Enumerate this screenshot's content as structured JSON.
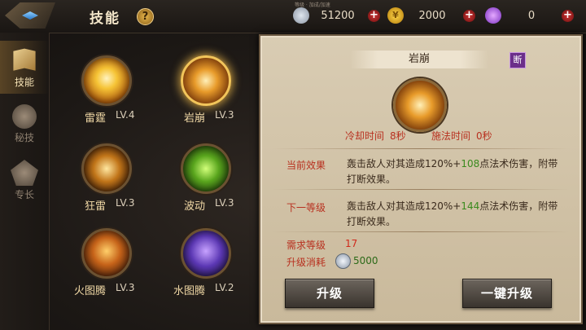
{
  "header": {
    "title": "技能",
    "help": "?",
    "small_tag": "等级 · 加成/加速",
    "resources": [
      {
        "name": "silver",
        "value": "51200",
        "icon": "gear-coin-icon"
      },
      {
        "name": "gold",
        "value": "2000",
        "icon": "gold-coin-icon"
      },
      {
        "name": "orb",
        "value": "0",
        "icon": "purple-orb-icon"
      }
    ],
    "plus": "+",
    "coin_glyph": "¥"
  },
  "nav": {
    "items": [
      {
        "label": "技能",
        "icon": "skill-book-icon",
        "active": true
      },
      {
        "label": "秘技",
        "icon": "secret-emblem-icon",
        "active": false
      },
      {
        "label": "专长",
        "icon": "specialty-emblem-icon",
        "active": false
      }
    ]
  },
  "skills": [
    {
      "name": "雷霆",
      "level": "LV.4",
      "art": "thunder-orb-icon"
    },
    {
      "name": "岩崩",
      "level": "LV.3",
      "art": "rock-burst-icon",
      "selected": true
    },
    {
      "name": "狂雷",
      "level": "LV.3",
      "art": "lightning-storm-icon"
    },
    {
      "name": "波动",
      "level": "LV.3",
      "art": "green-wave-icon"
    },
    {
      "name": "火图腾",
      "level": "LV.3",
      "art": "fire-totem-icon"
    },
    {
      "name": "水图腾",
      "level": "LV.2",
      "art": "water-totem-icon"
    }
  ],
  "detail": {
    "name": "岩崩",
    "badge": "断",
    "cooldown_label": "冷却时间",
    "cooldown_value": "8秒",
    "cast_label": "施法时间",
    "cast_value": "0秒",
    "current_label": "当前效果",
    "current_text_a": "轰击敌人对其造成120%+",
    "current_bonus": "108",
    "current_text_b": "点法术伤害，附带打断效果。",
    "next_label": "下一等级",
    "next_text_a": "轰击敌人对其造成120%+",
    "next_bonus": "144",
    "next_text_b": "点法术伤害，附带打断效果。",
    "req_label": "需求等级",
    "req_value": "17",
    "cost_label": "升级消耗",
    "cost_value": "5000",
    "upgrade_button": "升级",
    "upgrade_all_button": "一键升级"
  },
  "colors": {
    "accent_red": "#b8301f",
    "bonus_green": "#3a8a1e",
    "gold_ring": "#f2c55a"
  }
}
